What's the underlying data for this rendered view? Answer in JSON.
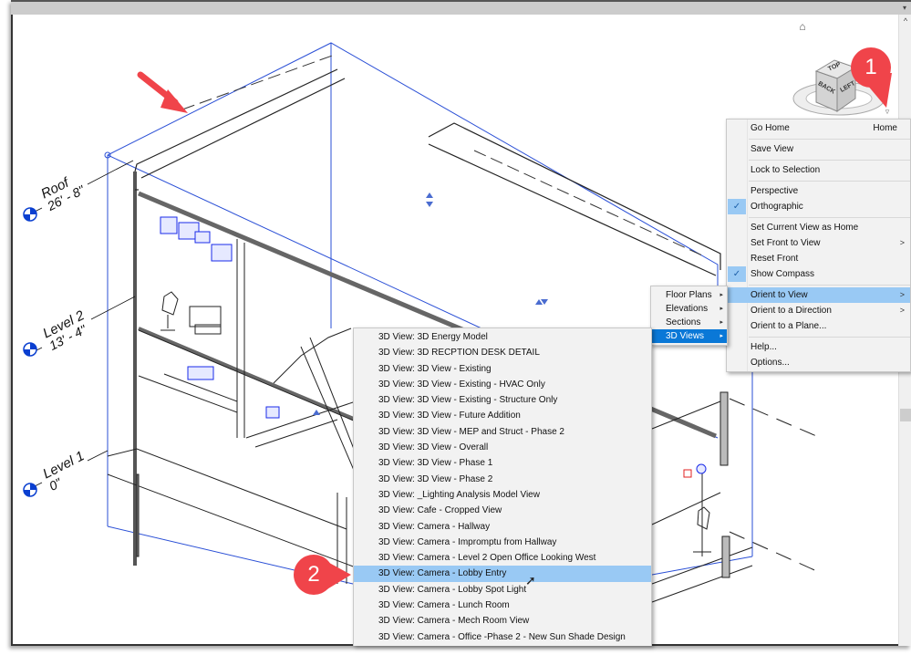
{
  "window": {
    "scroll_up_glyph": "^",
    "panel_menu_glyph": "▾"
  },
  "levels": [
    {
      "name": "Roof",
      "elevation": "26' - 8\""
    },
    {
      "name": "Level 2",
      "elevation": "13' - 4\""
    },
    {
      "name": "Level 1",
      "elevation": "0\""
    }
  ],
  "viewcube": {
    "home_icon": "home-icon",
    "faces": {
      "top": "TOP",
      "back": "BACK",
      "left": "LEFT"
    },
    "menu_button_glyph": "▿"
  },
  "callouts": [
    {
      "number": "1"
    },
    {
      "number": "2"
    }
  ],
  "context_menu": {
    "items": [
      {
        "label": "Go Home",
        "shortcut": "Home"
      },
      {
        "type": "separator"
      },
      {
        "label": "Save View"
      },
      {
        "type": "separator"
      },
      {
        "label": "Lock to Selection"
      },
      {
        "type": "separator"
      },
      {
        "label": "Perspective"
      },
      {
        "label": "Orthographic",
        "checked": true
      },
      {
        "type": "separator"
      },
      {
        "label": "Set Current View as Home"
      },
      {
        "label": "Set Front to View",
        "submenu": true
      },
      {
        "label": "Reset Front"
      },
      {
        "label": "Show Compass",
        "checked": true
      },
      {
        "type": "separator"
      },
      {
        "label": "Orient to View",
        "submenu": true,
        "highlighted": true
      },
      {
        "label": "Orient to a Direction",
        "submenu": true
      },
      {
        "label": "Orient to a Plane..."
      },
      {
        "type": "separator"
      },
      {
        "label": "Help..."
      },
      {
        "label": "Options..."
      }
    ],
    "check_glyph": "✓",
    "submenu_glyph": ">"
  },
  "view_type_menu": {
    "items": [
      {
        "label": "Floor Plans"
      },
      {
        "label": "Elevations"
      },
      {
        "label": "Sections"
      },
      {
        "label": "3D Views",
        "selected": true
      }
    ],
    "arrow_glyph": "▸"
  },
  "views_list": {
    "items": [
      "3D View: 3D Energy Model",
      "3D View: 3D RECPTION DESK DETAIL",
      "3D View: 3D View - Existing",
      "3D View: 3D View - Existing - HVAC Only",
      "3D View: 3D View - Existing - Structure Only",
      "3D View: 3D View - Future Addition",
      "3D View: 3D View - MEP and Struct - Phase 2",
      "3D View: 3D View - Overall",
      "3D View: 3D View - Phase 1",
      "3D View: 3D View - Phase 2",
      "3D View: _Lighting Analysis Model View",
      "3D View: Cafe - Cropped View",
      "3D View: Camera - Hallway",
      "3D View: Camera - Impromptu from Hallway",
      "3D View: Camera - Level 2 Open Office Looking West",
      "3D View: Camera - Lobby Entry",
      "3D View: Camera - Lobby Spot Light",
      "3D View: Camera - Lunch Room",
      "3D View: Camera - Mech Room View",
      "3D View: Camera - Office -Phase 2 - New Sun Shade Design"
    ],
    "highlighted_index": 15
  },
  "colors": {
    "highlight": "#99c9f4",
    "selected": "#0a78d7",
    "callout": "#f0444a",
    "section_box": "#2a4fd6",
    "level_head": "#0a3fd0"
  }
}
